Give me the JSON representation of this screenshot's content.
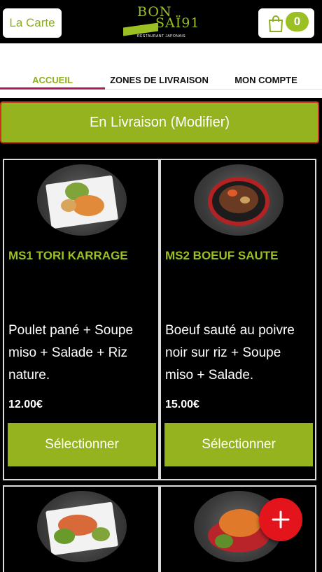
{
  "header": {
    "carte_label": "La Carte",
    "logo": {
      "line1": "BON",
      "line2": "SAÏ91",
      "subtitle": "RESTAURANT JAPONAIS"
    },
    "cart_count": "0"
  },
  "tabs": [
    {
      "label": "ACCUEIL",
      "active": true
    },
    {
      "label": "ZONES DE LIVRAISON",
      "active": false
    },
    {
      "label": "MON COMPTE",
      "active": false
    }
  ],
  "delivery_label": "En Livraison (Modifier)",
  "products": [
    {
      "title": "MS1 TORI KARRAGE",
      "description": "Poulet pané  + Soupe miso  + Salade  + Riz nature.",
      "price": "12.00€",
      "button": "Sélectionner"
    },
    {
      "title": "MS2 BOEUF SAUTE",
      "description": "Boeuf sauté au poivre noir sur riz  + Soupe miso  + Salade.",
      "price": "15.00€",
      "button": "Sélectionner"
    }
  ],
  "colors": {
    "accent": "#9bc023",
    "button": "#95b31f",
    "fab": "#e3141b",
    "tab_underline": "#b2185a"
  },
  "icons": {
    "cart": "shopping-bag-icon",
    "fab": "plus-icon"
  }
}
